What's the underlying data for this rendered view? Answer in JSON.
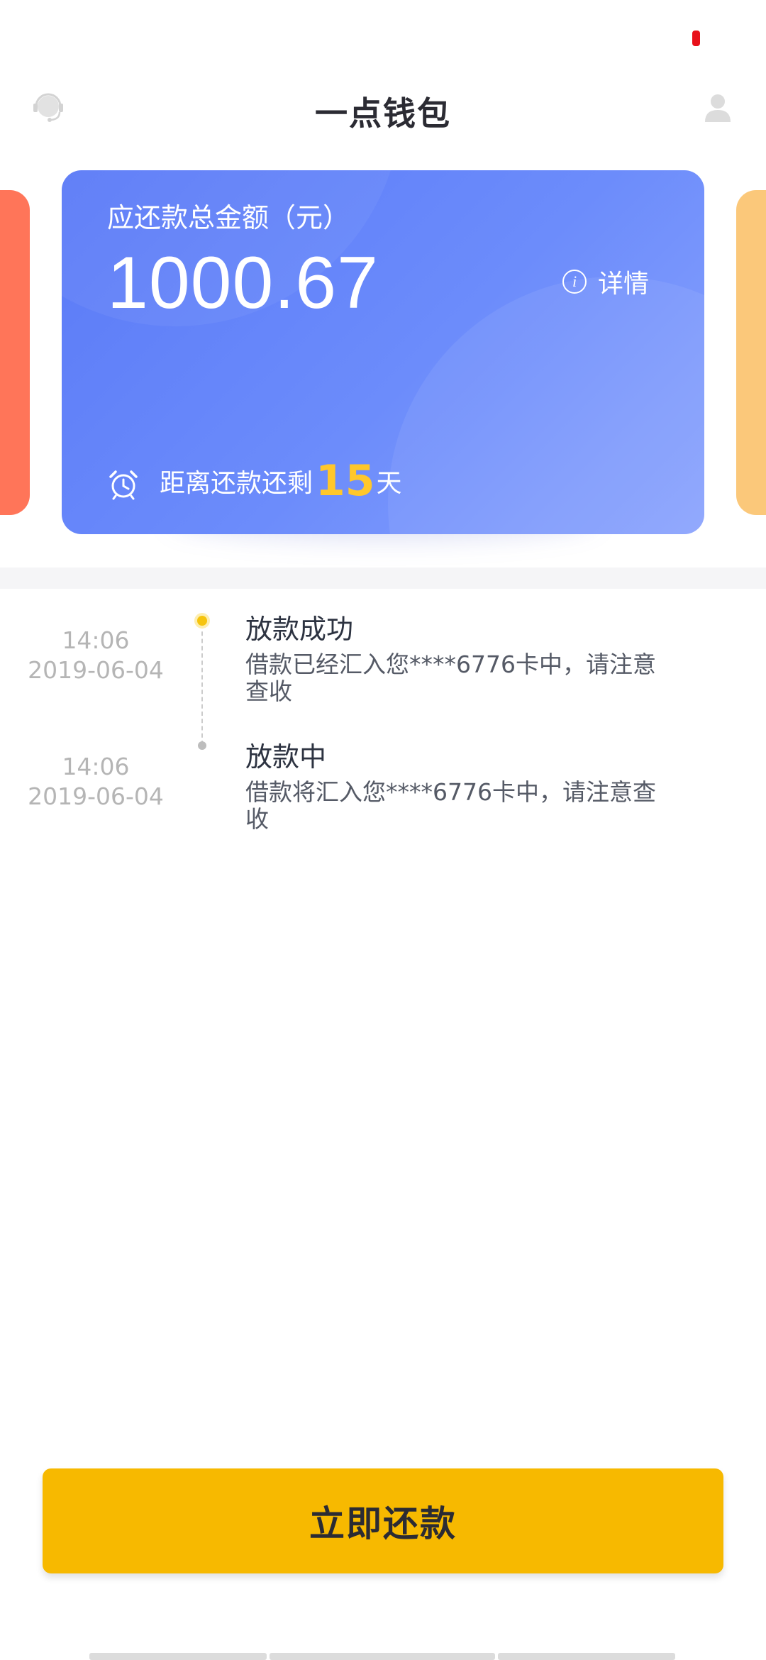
{
  "header": {
    "title": "一点钱包",
    "left_icon": "customer-service-icon",
    "right_icon": "user-icon"
  },
  "card": {
    "label": "应还款总金额（元）",
    "amount": "1000.67",
    "detail_label": "详情",
    "detail_icon": "info-icon",
    "countdown_prefix": "距离还款还剩",
    "countdown_days": "15",
    "countdown_suffix": "天",
    "countdown_icon": "alarm-clock-icon"
  },
  "timeline": [
    {
      "time": "14:06",
      "date": "2019-06-04",
      "title": "放款成功",
      "desc": "借款已经汇入您****6776卡中，请注意查收"
    },
    {
      "time": "14:06",
      "date": "2019-06-04",
      "title": "放款中",
      "desc": "借款将汇入您****6776卡中，请注意查收"
    }
  ],
  "repay_button": {
    "label": "立即还款"
  },
  "colors": {
    "card_gradient_start": "#5a7af7",
    "card_gradient_end": "#8aa3fd",
    "left_card": "#ff7559",
    "right_card": "#fbc87a",
    "accent_yellow": "#f7b900",
    "countdown_highlight": "#ffc72a"
  }
}
